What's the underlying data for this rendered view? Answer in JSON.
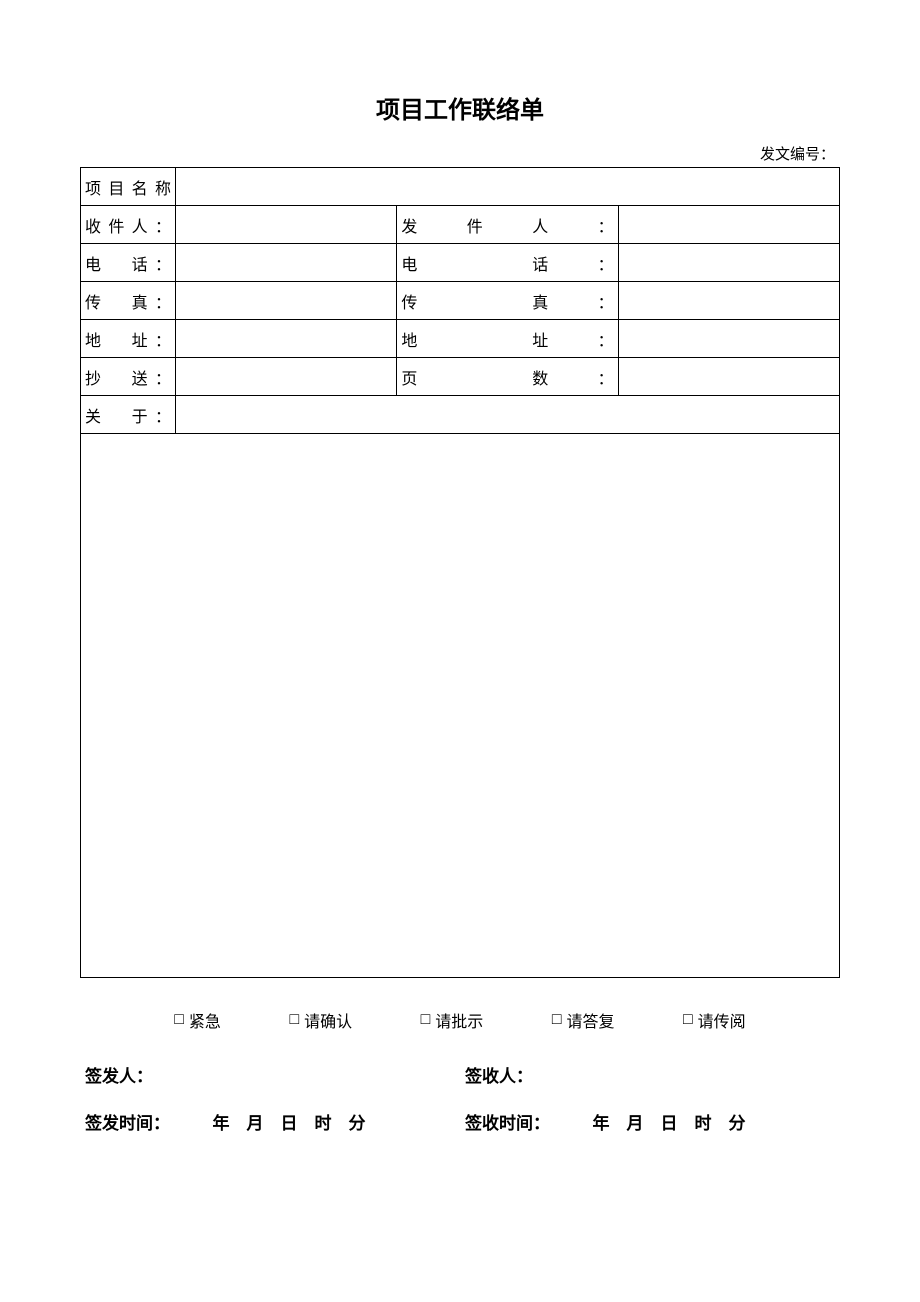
{
  "title": "项目工作联络单",
  "doc_number_label": "发文编号：",
  "fields": {
    "project_name": "项目名称",
    "recipient": "收件人：",
    "sender": "发件人：",
    "phone": "电　话：",
    "fax": "传　真：",
    "address": "地　址：",
    "cc": "抄　送：",
    "pages": "页　数：",
    "about": "关　于："
  },
  "values": {
    "project_name": "",
    "recipient": "",
    "sender": "",
    "phone_left": "",
    "phone_right": "",
    "fax_left": "",
    "fax_right": "",
    "address_left": "",
    "address_right": "",
    "cc": "",
    "pages": "",
    "about": "",
    "body": ""
  },
  "checkboxes": [
    {
      "label": "紧急"
    },
    {
      "label": "请确认"
    },
    {
      "label": "请批示"
    },
    {
      "label": "请答复"
    },
    {
      "label": "请传阅"
    }
  ],
  "sign": {
    "issuer_label": "签发人：",
    "receiver_label": "签收人：",
    "issue_time_label": "签发时间：",
    "receive_time_label": "签收时间：",
    "time_parts": "年　月　日　时　分"
  },
  "glyphs": {
    "checkbox": "□"
  }
}
